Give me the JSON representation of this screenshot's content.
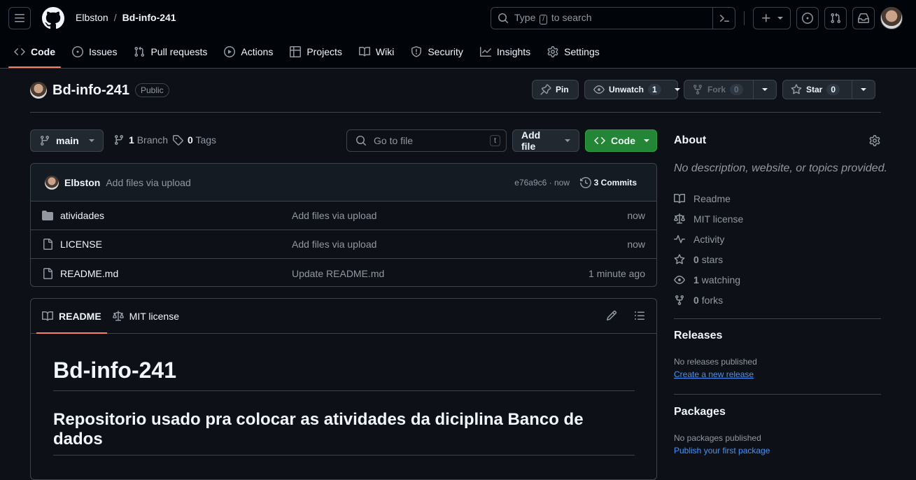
{
  "header": {
    "owner": "Elbston",
    "separator": "/",
    "repo": "Bd-info-241",
    "search_prefix": "Type",
    "search_key": "/",
    "search_suffix": "to search"
  },
  "tabs": [
    {
      "label": "Code",
      "icon": "code-icon"
    },
    {
      "label": "Issues",
      "icon": "issue-icon"
    },
    {
      "label": "Pull requests",
      "icon": "pull-request-icon"
    },
    {
      "label": "Actions",
      "icon": "play-icon"
    },
    {
      "label": "Projects",
      "icon": "table-icon"
    },
    {
      "label": "Wiki",
      "icon": "book-icon"
    },
    {
      "label": "Security",
      "icon": "shield-icon"
    },
    {
      "label": "Insights",
      "icon": "graph-icon"
    },
    {
      "label": "Settings",
      "icon": "gear-icon"
    }
  ],
  "repo": {
    "name": "Bd-info-241",
    "visibility": "Public",
    "pin_label": "Pin",
    "watch_label": "Unwatch",
    "watch_count": "1",
    "fork_label": "Fork",
    "fork_count": "0",
    "star_label": "Star",
    "star_count": "0"
  },
  "filenav": {
    "branch": "main",
    "branch_count": "1",
    "branch_label": "Branch",
    "tag_count": "0",
    "tag_label": "Tags",
    "goto_placeholder": "Go to file",
    "goto_key": "t",
    "add_file": "Add file",
    "code": "Code"
  },
  "latest_commit": {
    "author": "Elbston",
    "message": "Add files via upload",
    "sha_time": "e76a9c6 · now",
    "commits": "3 Commits"
  },
  "files": [
    {
      "type": "folder",
      "name": "atividades",
      "message": "Add files via upload",
      "time": "now"
    },
    {
      "type": "file",
      "name": "LICENSE",
      "message": "Add files via upload",
      "time": "now"
    },
    {
      "type": "file",
      "name": "README.md",
      "message": "Update README.md",
      "time": "1 minute ago"
    }
  ],
  "readme": {
    "tab_readme": "README",
    "tab_license": "MIT license",
    "h1": "Bd-info-241",
    "h2": "Repositorio usado pra colocar as atividades da diciplina Banco de dados"
  },
  "about": {
    "title": "About",
    "description": "No description, website, or topics provided.",
    "items": [
      {
        "icon": "book-icon",
        "count": "",
        "label": "Readme"
      },
      {
        "icon": "law-icon",
        "count": "",
        "label": "MIT license"
      },
      {
        "icon": "pulse-icon",
        "count": "",
        "label": "Activity"
      },
      {
        "icon": "star-icon",
        "count": "0",
        "label": "stars"
      },
      {
        "icon": "eye-icon",
        "count": "1",
        "label": "watching"
      },
      {
        "icon": "fork-icon",
        "count": "0",
        "label": "forks"
      }
    ]
  },
  "releases": {
    "title": "Releases",
    "note": "No releases published",
    "link": "Create a new release"
  },
  "packages": {
    "title": "Packages",
    "note": "No packages published",
    "link": "Publish your first package"
  }
}
